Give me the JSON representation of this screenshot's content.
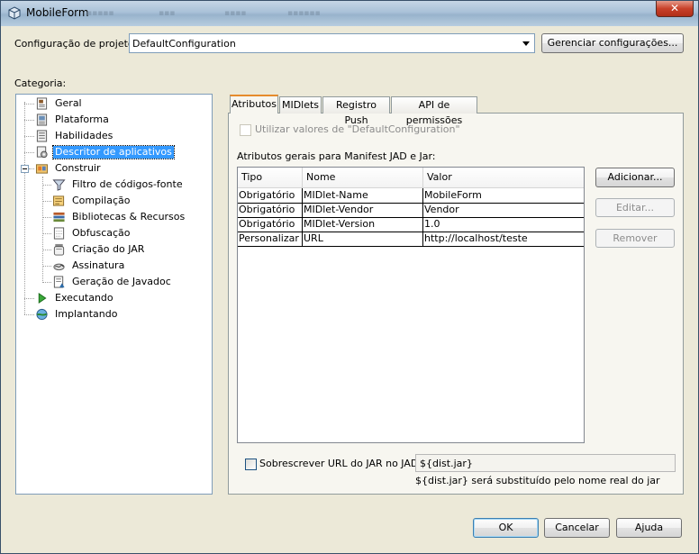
{
  "window": {
    "title": "MobileForm",
    "close_label": "✕"
  },
  "header": {
    "config_label": "Configuração de projeto:",
    "config_value": "DefaultConfiguration",
    "manage_button": "Gerenciar configurações..."
  },
  "category_label": "Categoria:",
  "tree": [
    {
      "label": "Geral",
      "icon": "document-icon",
      "level": 0
    },
    {
      "label": "Plataforma",
      "icon": "platform-icon",
      "level": 0
    },
    {
      "label": "Habilidades",
      "icon": "abilities-icon",
      "level": 0
    },
    {
      "label": "Descritor de aplicativos",
      "icon": "descriptor-icon",
      "level": 0,
      "selected": true
    },
    {
      "label": "Construir",
      "icon": "build-icon",
      "level": 0,
      "expanded": true
    },
    {
      "label": "Filtro de códigos-fonte",
      "icon": "filter-icon",
      "level": 1
    },
    {
      "label": "Compilação",
      "icon": "compile-icon",
      "level": 1
    },
    {
      "label": "Bibliotecas & Recursos",
      "icon": "libraries-icon",
      "level": 1
    },
    {
      "label": "Obfuscação",
      "icon": "obfuscation-icon",
      "level": 1
    },
    {
      "label": "Criação do JAR",
      "icon": "jar-icon",
      "level": 1
    },
    {
      "label": "Assinatura",
      "icon": "signature-icon",
      "level": 1
    },
    {
      "label": "Geração de Javadoc",
      "icon": "javadoc-icon",
      "level": 1
    },
    {
      "label": "Executando",
      "icon": "run-icon",
      "level": 0
    },
    {
      "label": "Implantando",
      "icon": "deploy-icon",
      "level": 0
    }
  ],
  "tabs": [
    {
      "label": "Atributos",
      "active": true
    },
    {
      "label": "MIDlets"
    },
    {
      "label": "Registro Push"
    },
    {
      "label": "API de permissões"
    }
  ],
  "use_default_label": "Utilizar valores de \"DefaultConfiguration\"",
  "section_label": "Atributos gerais para Manifest JAD e Jar:",
  "table": {
    "columns": [
      "Tipo",
      "Nome",
      "Valor"
    ],
    "rows": [
      [
        "Obrigatório",
        "MIDlet-Name",
        "MobileForm"
      ],
      [
        "Obrigatório",
        "MIDlet-Vendor",
        "Vendor"
      ],
      [
        "Obrigatório",
        "MIDlet-Version",
        "1.0"
      ],
      [
        "Personalizar",
        "URL",
        "http://localhost/teste"
      ]
    ]
  },
  "side_buttons": {
    "add": "Adicionar...",
    "edit": "Editar...",
    "remove": "Remover"
  },
  "override": {
    "label": "Sobrescrever URL do JAR no JAD:",
    "value": "${dist.jar}",
    "hint": "${dist.jar} será substituído pelo nome real do jar"
  },
  "footer": {
    "ok": "OK",
    "cancel": "Cancelar",
    "help": "Ajuda"
  },
  "colors": {
    "selection": "#3399ff",
    "tab_accent": "#e68b2c",
    "close": "#c8412a"
  }
}
